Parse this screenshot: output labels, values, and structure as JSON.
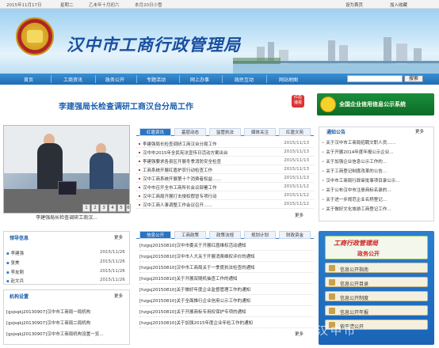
{
  "topbar": {
    "date": "2015年11月17日",
    "weekday": "星期二",
    "lunar": "乙未年十月初六",
    "solar_term": "本月20日小雪",
    "set_home": "设为首页",
    "add_fav": "加入收藏"
  },
  "banner": {
    "title": "汉中市工商行政管理局"
  },
  "nav": {
    "items": [
      "首页",
      "工商资讯",
      "政务公开",
      "专题活动",
      "网上办事",
      "政民互动",
      "网站地图"
    ],
    "search_button": "搜索"
  },
  "headline": {
    "text": "李建强局长检查调研工商汉台分局工作",
    "badge_a": "红盾",
    "badge_b": "播报"
  },
  "credit_banner": {
    "text": "全国企业信用信息公示系统"
  },
  "photo": {
    "caption": "李建强局长检查调研工商汉...",
    "pages": [
      "1",
      "2",
      "3",
      "4",
      "5",
      "6"
    ]
  },
  "news_tabs": {
    "tabs": [
      "红盾资讯",
      "基层动态",
      "监管执法",
      "媒体关注",
      "红盾文苑"
    ],
    "active": 0,
    "items": [
      {
        "text": "李建强局长检查调研工商汉台分局工作",
        "date": "2015/11/13"
      },
      {
        "text": "汉中市2015年全民宪法宣传日活动方案出台",
        "date": "2015/11/13"
      },
      {
        "text": "李建强要求各县区开展冬季消防安全检查",
        "date": "2015/11/13"
      },
      {
        "text": "工商系统开展红盾护农行动检查工作",
        "date": "2015/11/13"
      },
      {
        "text": "汉中工商系统开展第十个消费者权益……",
        "date": "2015/11/13"
      },
      {
        "text": "汉中市召开全市工商所长会议部署工作",
        "date": "2015/11/12"
      },
      {
        "text": "汉中工商局开展打击侵权假冒专项行动",
        "date": "2015/11/12"
      },
      {
        "text": "汉中工商人事调整工作会议召开……",
        "date": "2015/11/12"
      }
    ],
    "more": "更多"
  },
  "notice": {
    "title": "通知公告",
    "more": "更多",
    "items": [
      "关于汉中市工商局招聘文职人员……",
      "关于开展2014年度年报公示企业…",
      "关于加强企业信息公示工作的…",
      "关于工商登记制度改革的公告…",
      "汉中市工商局行政审批事项目录公示…",
      "关于公布汉中市注册商标名录的…",
      "关于进一步规范企业名称登记…",
      "关于做好文化旅游工商登记工作…"
    ]
  },
  "leader": {
    "title": "领导信息",
    "more": "更多",
    "items": [
      {
        "text": "李建强",
        "date": "2015/11/26"
      },
      {
        "text": "张美",
        "date": "2015/11/26"
      },
      {
        "text": "李友刚",
        "date": "2015/11/26"
      },
      {
        "text": "赵文兵",
        "date": "2015/11/26"
      }
    ]
  },
  "agency": {
    "title": "机构设置",
    "more": "更多",
    "items": [
      "[gsjsqkj20130907]汉中市工商局一局机构",
      "[gsjsqkj20130907]汉中市工商局二局机构",
      "[gsjsqkj20130907]汉中市工商局机构设置一览…"
    ]
  },
  "public_tabs": {
    "tabs": [
      "信息公开",
      "工商政策",
      "政策法规",
      "规划计划",
      "财政资金"
    ],
    "active": 0,
    "items": [
      "[hzgsj20150810]汉中市委关于开展红盾维权活动通知",
      "[hzgsj20150810]汉中市人大关于开展消费维权评价的通知",
      "[hzgsj20150810]汉中市工商局关于一季度执法检查的通知",
      "[hzgsj20150810]关于开展双随机抽查工作的通知",
      "[hzgsj20150810]关于做好年度企业监督管理工作的通知",
      "[hzgsj20150810]关于全面推行企业信用公示工作的通知",
      "[hzgsj20150810]关于开展商标专用权保护专项的通知",
      "[hzgsj20150810]关于加强2015年度企业年检工作的通知"
    ],
    "more": "更多"
  },
  "gov_open": {
    "title_a": "工商行政管理局",
    "title_b": "政务公开",
    "buttons": [
      "信息公开指南",
      "信息公开目录",
      "信息公开制度",
      "信息公开年报",
      "依申请公开"
    ]
  },
  "watermark": "汉中市"
}
